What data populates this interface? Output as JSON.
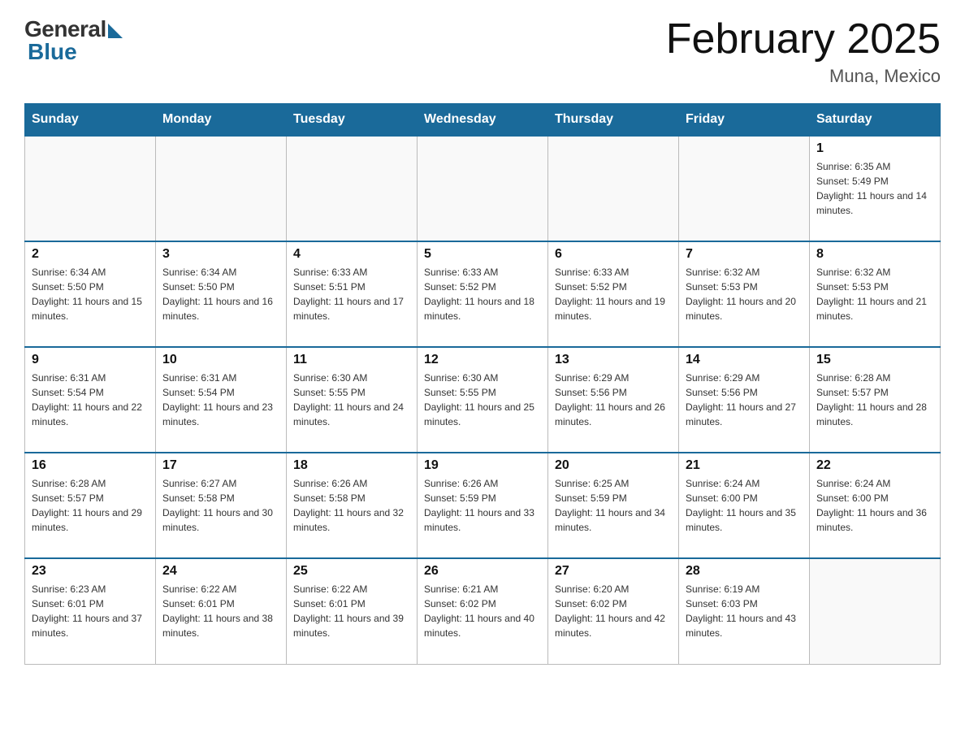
{
  "logo": {
    "general": "General",
    "blue": "Blue"
  },
  "title": "February 2025",
  "location": "Muna, Mexico",
  "days_of_week": [
    "Sunday",
    "Monday",
    "Tuesday",
    "Wednesday",
    "Thursday",
    "Friday",
    "Saturday"
  ],
  "weeks": [
    [
      {
        "day": "",
        "info": ""
      },
      {
        "day": "",
        "info": ""
      },
      {
        "day": "",
        "info": ""
      },
      {
        "day": "",
        "info": ""
      },
      {
        "day": "",
        "info": ""
      },
      {
        "day": "",
        "info": ""
      },
      {
        "day": "1",
        "info": "Sunrise: 6:35 AM\nSunset: 5:49 PM\nDaylight: 11 hours and 14 minutes."
      }
    ],
    [
      {
        "day": "2",
        "info": "Sunrise: 6:34 AM\nSunset: 5:50 PM\nDaylight: 11 hours and 15 minutes."
      },
      {
        "day": "3",
        "info": "Sunrise: 6:34 AM\nSunset: 5:50 PM\nDaylight: 11 hours and 16 minutes."
      },
      {
        "day": "4",
        "info": "Sunrise: 6:33 AM\nSunset: 5:51 PM\nDaylight: 11 hours and 17 minutes."
      },
      {
        "day": "5",
        "info": "Sunrise: 6:33 AM\nSunset: 5:52 PM\nDaylight: 11 hours and 18 minutes."
      },
      {
        "day": "6",
        "info": "Sunrise: 6:33 AM\nSunset: 5:52 PM\nDaylight: 11 hours and 19 minutes."
      },
      {
        "day": "7",
        "info": "Sunrise: 6:32 AM\nSunset: 5:53 PM\nDaylight: 11 hours and 20 minutes."
      },
      {
        "day": "8",
        "info": "Sunrise: 6:32 AM\nSunset: 5:53 PM\nDaylight: 11 hours and 21 minutes."
      }
    ],
    [
      {
        "day": "9",
        "info": "Sunrise: 6:31 AM\nSunset: 5:54 PM\nDaylight: 11 hours and 22 minutes."
      },
      {
        "day": "10",
        "info": "Sunrise: 6:31 AM\nSunset: 5:54 PM\nDaylight: 11 hours and 23 minutes."
      },
      {
        "day": "11",
        "info": "Sunrise: 6:30 AM\nSunset: 5:55 PM\nDaylight: 11 hours and 24 minutes."
      },
      {
        "day": "12",
        "info": "Sunrise: 6:30 AM\nSunset: 5:55 PM\nDaylight: 11 hours and 25 minutes."
      },
      {
        "day": "13",
        "info": "Sunrise: 6:29 AM\nSunset: 5:56 PM\nDaylight: 11 hours and 26 minutes."
      },
      {
        "day": "14",
        "info": "Sunrise: 6:29 AM\nSunset: 5:56 PM\nDaylight: 11 hours and 27 minutes."
      },
      {
        "day": "15",
        "info": "Sunrise: 6:28 AM\nSunset: 5:57 PM\nDaylight: 11 hours and 28 minutes."
      }
    ],
    [
      {
        "day": "16",
        "info": "Sunrise: 6:28 AM\nSunset: 5:57 PM\nDaylight: 11 hours and 29 minutes."
      },
      {
        "day": "17",
        "info": "Sunrise: 6:27 AM\nSunset: 5:58 PM\nDaylight: 11 hours and 30 minutes."
      },
      {
        "day": "18",
        "info": "Sunrise: 6:26 AM\nSunset: 5:58 PM\nDaylight: 11 hours and 32 minutes."
      },
      {
        "day": "19",
        "info": "Sunrise: 6:26 AM\nSunset: 5:59 PM\nDaylight: 11 hours and 33 minutes."
      },
      {
        "day": "20",
        "info": "Sunrise: 6:25 AM\nSunset: 5:59 PM\nDaylight: 11 hours and 34 minutes."
      },
      {
        "day": "21",
        "info": "Sunrise: 6:24 AM\nSunset: 6:00 PM\nDaylight: 11 hours and 35 minutes."
      },
      {
        "day": "22",
        "info": "Sunrise: 6:24 AM\nSunset: 6:00 PM\nDaylight: 11 hours and 36 minutes."
      }
    ],
    [
      {
        "day": "23",
        "info": "Sunrise: 6:23 AM\nSunset: 6:01 PM\nDaylight: 11 hours and 37 minutes."
      },
      {
        "day": "24",
        "info": "Sunrise: 6:22 AM\nSunset: 6:01 PM\nDaylight: 11 hours and 38 minutes."
      },
      {
        "day": "25",
        "info": "Sunrise: 6:22 AM\nSunset: 6:01 PM\nDaylight: 11 hours and 39 minutes."
      },
      {
        "day": "26",
        "info": "Sunrise: 6:21 AM\nSunset: 6:02 PM\nDaylight: 11 hours and 40 minutes."
      },
      {
        "day": "27",
        "info": "Sunrise: 6:20 AM\nSunset: 6:02 PM\nDaylight: 11 hours and 42 minutes."
      },
      {
        "day": "28",
        "info": "Sunrise: 6:19 AM\nSunset: 6:03 PM\nDaylight: 11 hours and 43 minutes."
      },
      {
        "day": "",
        "info": ""
      }
    ]
  ]
}
